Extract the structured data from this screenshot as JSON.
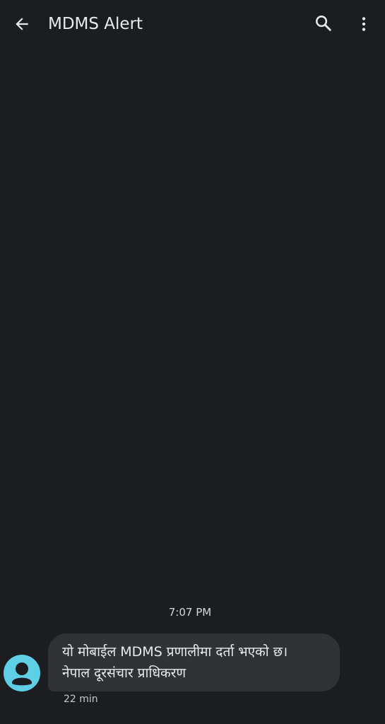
{
  "header": {
    "title": "MDMS Alert",
    "back_icon": "arrow-left-icon",
    "search_icon": "search-icon",
    "more_icon": "more-vert-icon"
  },
  "thread": {
    "messages": [
      {
        "time_label": "7:07 PM",
        "sender_avatar": "person-icon",
        "lines": [
          "यो मोबाईल MDMS प्रणालीमा दर्ता भएको छ।",
          "नेपाल दूरसंचार प्राधिकरण"
        ],
        "relative_time": "22 min"
      }
    ]
  },
  "colors": {
    "background": "#1b1d20",
    "bubble": "#303235",
    "avatar": "#5fcfe6",
    "text": "#e8eaed"
  }
}
